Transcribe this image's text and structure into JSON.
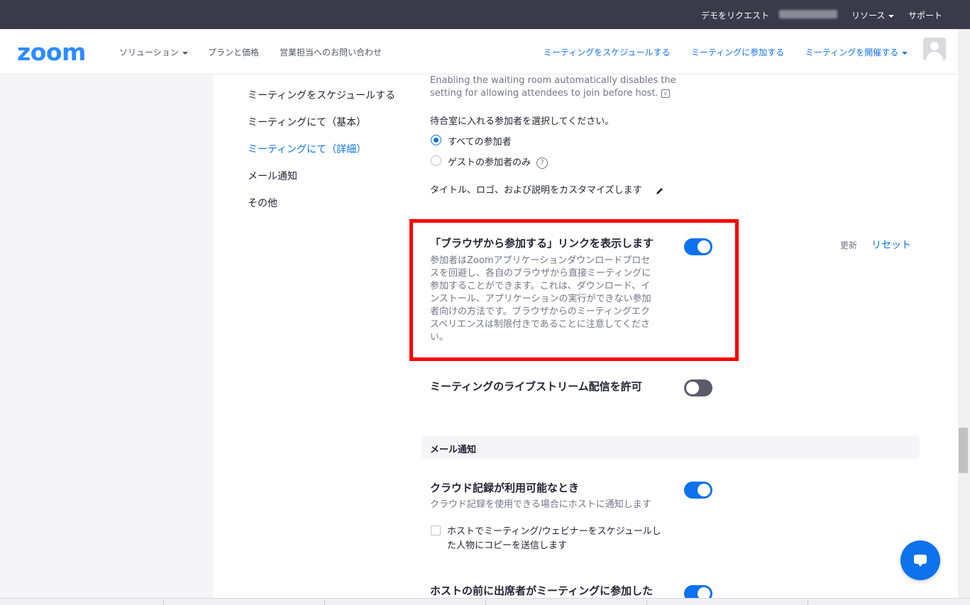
{
  "topbar": {
    "request_demo": "デモをリクエスト",
    "resources": "リソース",
    "support": "サポート"
  },
  "nav": {
    "logo": "zoom",
    "solutions": "ソリューション",
    "plans": "プランと価格",
    "contact_sales": "営業担当へのお問い合わせ",
    "schedule": "ミーティングをスケジュールする",
    "join": "ミーティングに参加する",
    "host": "ミーティングを開催する"
  },
  "sidebar": {
    "items": [
      {
        "label": "ミーティングをスケジュールする",
        "active": false
      },
      {
        "label": "ミーティングにて（基本）",
        "active": false
      },
      {
        "label": "ミーティングにて（詳細）",
        "active": true
      },
      {
        "label": "メール通知",
        "active": false
      },
      {
        "label": "その他",
        "active": false
      }
    ]
  },
  "waiting_room": {
    "note_line1": "Enabling the waiting room automatically disables the",
    "note_line2": "setting for allowing attendees to join before host.",
    "select_prompt": "待合室に入れる参加者を選択してください。",
    "option_all": "すべての参加者",
    "option_guest": "ゲストの参加者のみ",
    "customize": "タイトル、ロゴ、および説明をカスタマイズします"
  },
  "browser_join": {
    "title": "「ブラウザから参加する」リンクを表示します",
    "desc_lines": [
      "参加者はZoomアプリケーションダウンロードプロセ",
      "スを回避し、各自のブラウザから直接ミーティングに",
      "参加することができます。これは、ダウンロード、イ",
      "ンストール、アプリケーションの実行ができない参加",
      "者向けの方法です。ブラウザからのミーティングエク",
      "スペリエンスは制限付きであることに注意してくださ",
      "い。"
    ],
    "enabled": true,
    "updated": "更新",
    "reset": "リセット"
  },
  "livestream": {
    "title": "ミーティングのライブストリーム配信を許可",
    "enabled": false
  },
  "email_section": {
    "header": "メール通知"
  },
  "cloud_recording": {
    "title": "クラウド記録が利用可能なとき",
    "desc": "クラウド記録を使用できる場合にホストに通知します",
    "enabled": true,
    "checkbox_line1": "ホストでミーティング/ウェビナーをスケジュールし",
    "checkbox_line2": "た人物にコピーを送信します"
  },
  "join_before_host": {
    "title": "ホストの前に出席者がミーティングに参加した",
    "enabled": true
  },
  "icons": {
    "chat": "chat-icon",
    "edit": "pencil-icon",
    "help": "question-icon",
    "avatar": "user-avatar-icon"
  },
  "colors": {
    "brand": "#2d8cff",
    "link": "#0e72ed",
    "highlight": "#ff0000",
    "topbar": "#3a3a4a"
  }
}
